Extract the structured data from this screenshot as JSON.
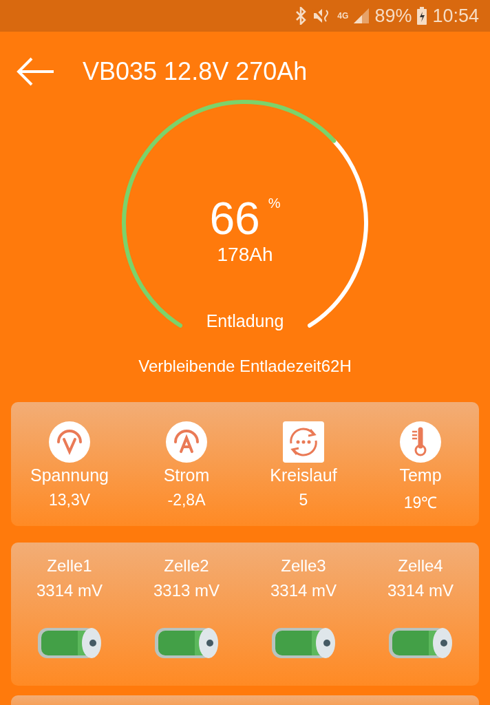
{
  "status_bar": {
    "network": "4G",
    "battery": "89%",
    "time": "10:54"
  },
  "header": {
    "title": "VB035 12.8V 270Ah"
  },
  "gauge": {
    "percent": "66",
    "unit": "%",
    "capacity": "178Ah",
    "mode": "Entladung"
  },
  "remaining": "Verbleibende Entladezeit62H",
  "metrics": [
    {
      "kind": "voltage",
      "label": "Spannung",
      "value": "13,3V"
    },
    {
      "kind": "current",
      "label": "Strom",
      "value": "-2,8A"
    },
    {
      "kind": "cycle",
      "label": "Kreislauf",
      "value": "5"
    },
    {
      "kind": "temp",
      "label": "Temp",
      "value": "19℃"
    }
  ],
  "cells": [
    {
      "label": "Zelle1",
      "value": "3314 mV"
    },
    {
      "label": "Zelle2",
      "value": "3313 mV"
    },
    {
      "label": "Zelle3",
      "value": "3314 mV"
    },
    {
      "label": "Zelle4",
      "value": "3314 mV"
    }
  ]
}
